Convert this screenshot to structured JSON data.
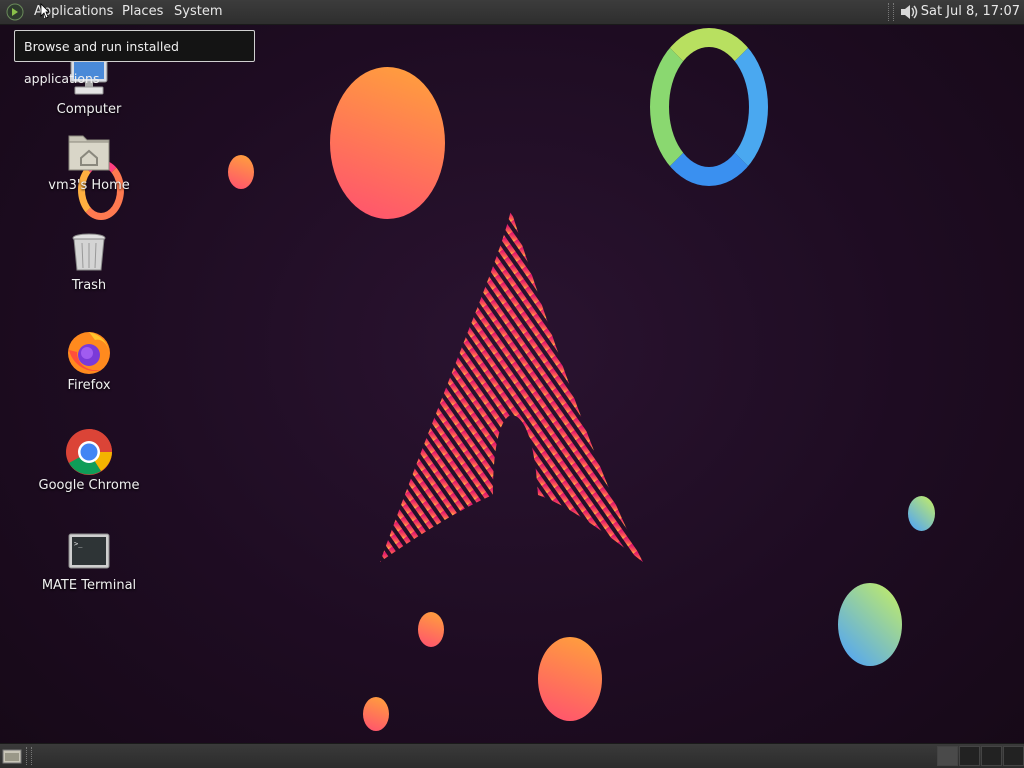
{
  "top_panel": {
    "menus": [
      "Applications",
      "Places",
      "System"
    ],
    "clock": "Sat Jul  8, 17:07",
    "icons": {
      "logo": "mate-logo-icon",
      "volume": "volume-icon"
    }
  },
  "tooltip": {
    "text": "Browse and run installed applications"
  },
  "desktop_icons": [
    {
      "label": "Computer",
      "icon": "computer-icon"
    },
    {
      "label": "vm3's Home",
      "icon": "home-folder-icon"
    },
    {
      "label": "Trash",
      "icon": "trash-icon"
    },
    {
      "label": "Firefox",
      "icon": "firefox-icon"
    },
    {
      "label": "Google Chrome",
      "icon": "chrome-icon"
    },
    {
      "label": "MATE Terminal",
      "icon": "terminal-icon"
    }
  ],
  "bottom_panel": {
    "icons": {
      "show_desktop": "show-desktop-icon"
    },
    "workspaces": 4,
    "active_workspace": 1
  },
  "colors": {
    "background": "#1e0c22",
    "panel": "#333333",
    "accent_pink": "#e8206e",
    "accent_orange": "#ff8a3a"
  }
}
